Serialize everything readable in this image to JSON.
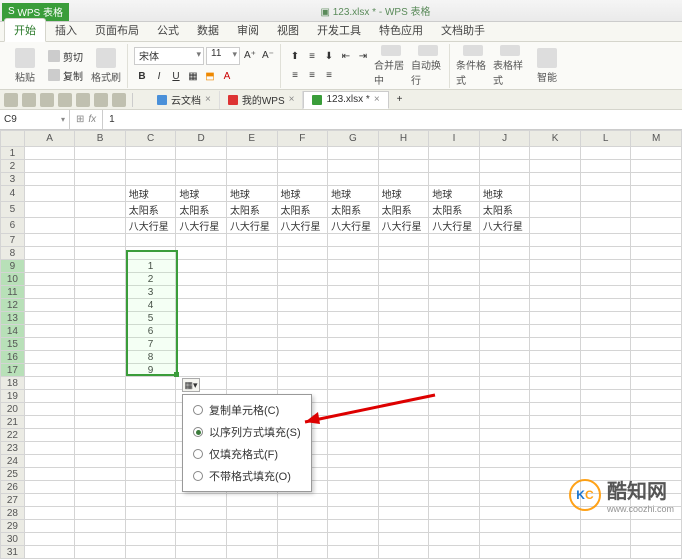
{
  "app": {
    "name": "WPS 表格",
    "title_doc": "123.xlsx *",
    "title_suffix": "WPS 表格"
  },
  "menu": {
    "tabs": [
      "开始",
      "插入",
      "页面布局",
      "公式",
      "数据",
      "审阅",
      "视图",
      "开发工具",
      "特色应用",
      "文档助手"
    ],
    "active": 0
  },
  "ribbon": {
    "paste": "粘贴",
    "cut": "剪切",
    "copy": "复制",
    "fmtpaint": "格式刷",
    "font_name": "宋体",
    "font_size": "11",
    "merge": "合并居中",
    "wrap": "自动换行",
    "cond_fmt": "条件格式",
    "table_style": "表格样式",
    "smart": "智能"
  },
  "doctabs": {
    "cloud": "云文档",
    "mywps": "我的WPS",
    "file": "123.xlsx *"
  },
  "formula": {
    "name": "C9",
    "value": "1"
  },
  "columns": [
    "A",
    "B",
    "C",
    "D",
    "E",
    "F",
    "G",
    "H",
    "I",
    "J",
    "K",
    "L",
    "M"
  ],
  "rows": 31,
  "cells": {
    "r4": {
      "c3": "地球",
      "c4": "地球",
      "c5": "地球",
      "c6": "地球",
      "c7": "地球",
      "c8": "地球",
      "c9": "地球",
      "c10": "地球"
    },
    "r5": {
      "c3": "太阳系",
      "c4": "太阳系",
      "c5": "太阳系",
      "c6": "太阳系",
      "c7": "太阳系",
      "c8": "太阳系",
      "c9": "太阳系",
      "c10": "太阳系"
    },
    "r6": {
      "c3": "八大行星",
      "c4": "八大行星",
      "c5": "八大行星",
      "c6": "八大行星",
      "c7": "八大行星",
      "c8": "八大行星",
      "c9": "八大行星",
      "c10": "八大行星"
    },
    "r9": {
      "c3": "1"
    },
    "r10": {
      "c3": "2"
    },
    "r11": {
      "c3": "3"
    },
    "r12": {
      "c3": "4"
    },
    "r13": {
      "c3": "5"
    },
    "r14": {
      "c3": "6"
    },
    "r15": {
      "c3": "7"
    },
    "r16": {
      "c3": "8"
    },
    "r17": {
      "c3": "9"
    }
  },
  "autofill": {
    "button": "⿻",
    "options": [
      {
        "label": "复制单元格(C)",
        "checked": false
      },
      {
        "label": "以序列方式填充(S)",
        "checked": true
      },
      {
        "label": "仅填充格式(F)",
        "checked": false
      },
      {
        "label": "不带格式填充(O)",
        "checked": false
      }
    ]
  },
  "watermark": {
    "brand": "酷知网",
    "url": "www.coozhi.com"
  }
}
